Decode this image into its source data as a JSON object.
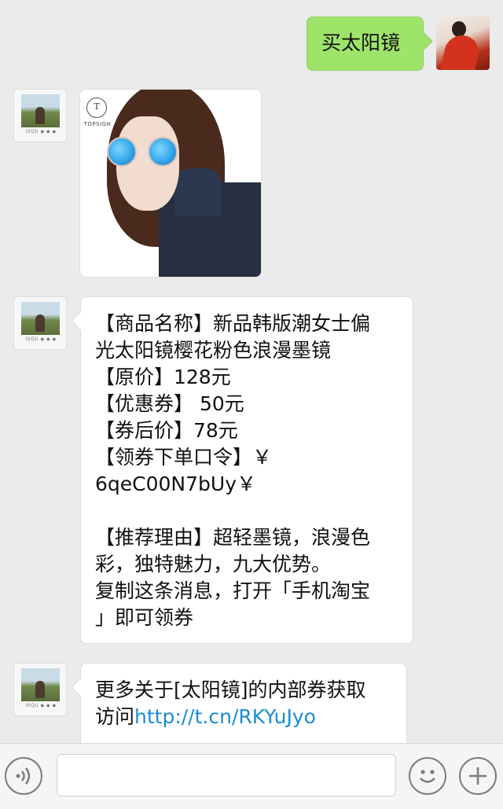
{
  "messages": [
    {
      "sender": "user",
      "type": "text",
      "text": "买太阳镜"
    },
    {
      "sender": "bot",
      "type": "image",
      "image_description": "model wearing blue mirrored sunglasses",
      "logo_text": "TOPSIGH",
      "logo_mark": "T"
    },
    {
      "sender": "bot",
      "type": "text",
      "text": "【商品名称】新品韩版潮女士偏\n光太阳镜樱花粉色浪漫墨镜\n【原价】128元\n【优惠券】 50元\n【券后价】78元\n【领券下单口令】￥\n6qeC00N7bUy￥\n\n【推荐理由】超轻墨镜，浪漫色\n彩，独特魅力，九大优势。\n复制这条消息，打开「手机淘宝\n」即可领券"
    },
    {
      "sender": "bot",
      "type": "text",
      "text_prefix": "更多关于[太阳镜]的内部券获取\n访问",
      "link": "http://t.cn/RKYuJyo"
    }
  ],
  "bot_avatar": {
    "caption": "ISQU ◆ ◆ ◆"
  },
  "input_bar": {
    "voice_icon": "voice-icon",
    "emoji_icon": "emoji-icon",
    "plus_icon": "plus-icon",
    "placeholder": ""
  },
  "colors": {
    "chat_background": "#ebebeb",
    "user_bubble": "#9fe46a",
    "bot_bubble": "#ffffff",
    "link": "#1a8dd6"
  }
}
